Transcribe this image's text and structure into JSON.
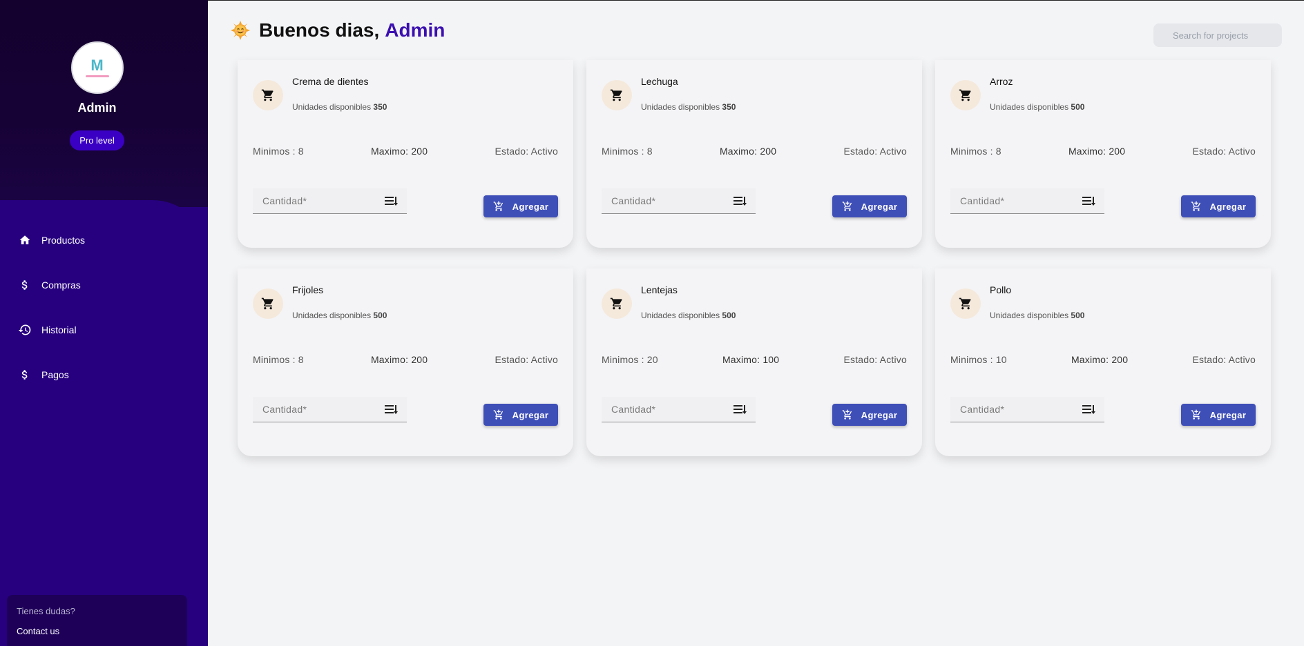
{
  "sidebar": {
    "profile_name": "Admin",
    "badge_label": "Pro level",
    "nav": [
      {
        "label": "Productos",
        "icon": "home-icon"
      },
      {
        "label": "Compras",
        "icon": "dollar-icon"
      },
      {
        "label": "Historial",
        "icon": "history-icon"
      },
      {
        "label": "Pagos",
        "icon": "dollar-icon"
      }
    ],
    "help": {
      "question": "Tienes dudas?",
      "link": "Contact us"
    }
  },
  "header": {
    "greeting": "Buenos dias,",
    "user": "Admin",
    "search_placeholder": "Search for projects"
  },
  "units_prefix": "Unidades disponibles",
  "qty_placeholder": "Cantidad*",
  "add_label": "Agregar",
  "products": [
    {
      "name": "Crema de dientes",
      "units": "350",
      "min": "Minimos : 8",
      "max": "Maximo: 200",
      "status": "Estado: Activo"
    },
    {
      "name": "Lechuga",
      "units": "350",
      "min": "Minimos : 8",
      "max": "Maximo: 200",
      "status": "Estado: Activo"
    },
    {
      "name": "Arroz",
      "units": "500",
      "min": "Minimos : 8",
      "max": "Maximo: 200",
      "status": "Estado: Activo"
    },
    {
      "name": "Frijoles",
      "units": "500",
      "min": "Minimos : 8",
      "max": "Maximo: 200",
      "status": "Estado: Activo"
    },
    {
      "name": "Lentejas",
      "units": "500",
      "min": "Minimos : 20",
      "max": "Maximo: 100",
      "status": "Estado: Activo"
    },
    {
      "name": "Pollo",
      "units": "500",
      "min": "Minimos : 10",
      "max": "Maximo: 200",
      "status": "Estado: Activo"
    }
  ],
  "colors": {
    "sidebar": "#27007f",
    "sidebar_top": "#14012e",
    "accent": "#3b0fb0",
    "button": "#3f4fb8"
  }
}
